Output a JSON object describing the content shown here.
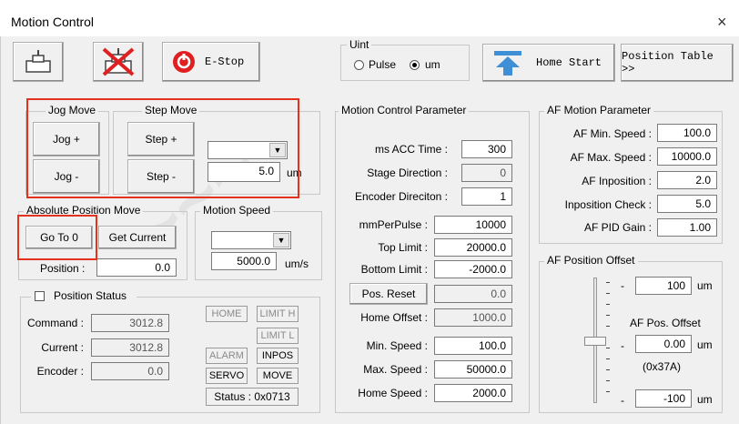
{
  "window": {
    "title": "Motion Control",
    "close_glyph": "×"
  },
  "toolbar": {
    "estop_label": "E-Stop",
    "home_start_label": "Home Start",
    "position_table_label": "Position Table >>"
  },
  "unit": {
    "title": "Uint",
    "pulse_label": "Pulse",
    "um_label": "um",
    "selected": "um"
  },
  "jog_move": {
    "title": "Jog Move",
    "plus_label": "Jog +",
    "minus_label": "Jog -"
  },
  "step_move": {
    "title": "Step Move",
    "plus_label": "Step +",
    "minus_label": "Step -",
    "combo_value": "",
    "step_value": "5.0",
    "unit": "um"
  },
  "absolute_move": {
    "title": "Absolute Position Move",
    "goto_label": "Go To 0",
    "get_current_label": "Get Current",
    "position_label": "Position :",
    "position_value": "0.0"
  },
  "motion_speed": {
    "title": "Motion Speed",
    "combo_value": "",
    "speed_value": "5000.0",
    "unit": "um/s"
  },
  "position_status": {
    "title": "Position Status",
    "command_label": "Command :",
    "command_value": "3012.8",
    "current_label": "Current :",
    "current_value": "3012.8",
    "encoder_label": "Encoder :",
    "encoder_value": "0.0",
    "home": "HOME",
    "limit_h": "LIMIT H",
    "limit_l": "LIMIT L",
    "alarm": "ALARM",
    "inpos": "INPOS",
    "servo": "SERVO",
    "move": "MOVE",
    "status_text": "Status : 0x0713"
  },
  "mcp": {
    "title": "Motion Control Parameter",
    "rows": [
      {
        "label": "ms ACC Time :",
        "value": "300"
      },
      {
        "label": "Stage Direction :",
        "value": "0"
      },
      {
        "label": "Encoder Direciton :",
        "value": "1"
      },
      {
        "label": "mmPerPulse :",
        "value": "10000"
      },
      {
        "label": "Top Limit :",
        "value": "20000.0"
      },
      {
        "label": "Bottom Limit :",
        "value": "-2000.0"
      },
      {
        "label": "Pos. Reset",
        "value": "0.0"
      },
      {
        "label": "Home Offset :",
        "value": "1000.0"
      },
      {
        "label": "Min. Speed :",
        "value": "100.0"
      },
      {
        "label": "Max. Speed :",
        "value": "50000.0"
      },
      {
        "label": "Home Speed :",
        "value": "2000.0"
      }
    ]
  },
  "af": {
    "title": "AF Motion Parameter",
    "rows": [
      {
        "label": "AF Min. Speed :",
        "value": "100.0"
      },
      {
        "label": "AF Max. Speed :",
        "value": "10000.0"
      },
      {
        "label": "AF Inposition :",
        "value": "2.0"
      },
      {
        "label": "Inposition Check :",
        "value": "5.0"
      },
      {
        "label": "AF PID Gain :",
        "value": "1.00"
      }
    ]
  },
  "af_offset": {
    "title": "AF Position Offset",
    "top_value": "100",
    "mid_value": "0.00",
    "bottom_value": "-100",
    "unit": "um",
    "dash": "-",
    "label": "AF Pos. Offset",
    "hex": "(0x37A)"
  },
  "icons": [
    "stage-icon",
    "stage-disabled-icon",
    "estop-icon",
    "home-arrow-icon",
    "combo-arrow-icon",
    "close-icon"
  ],
  "colors": {
    "highlight": "#e3331f",
    "estop": "#e02020",
    "home_arrow": "#3f8fd6"
  }
}
